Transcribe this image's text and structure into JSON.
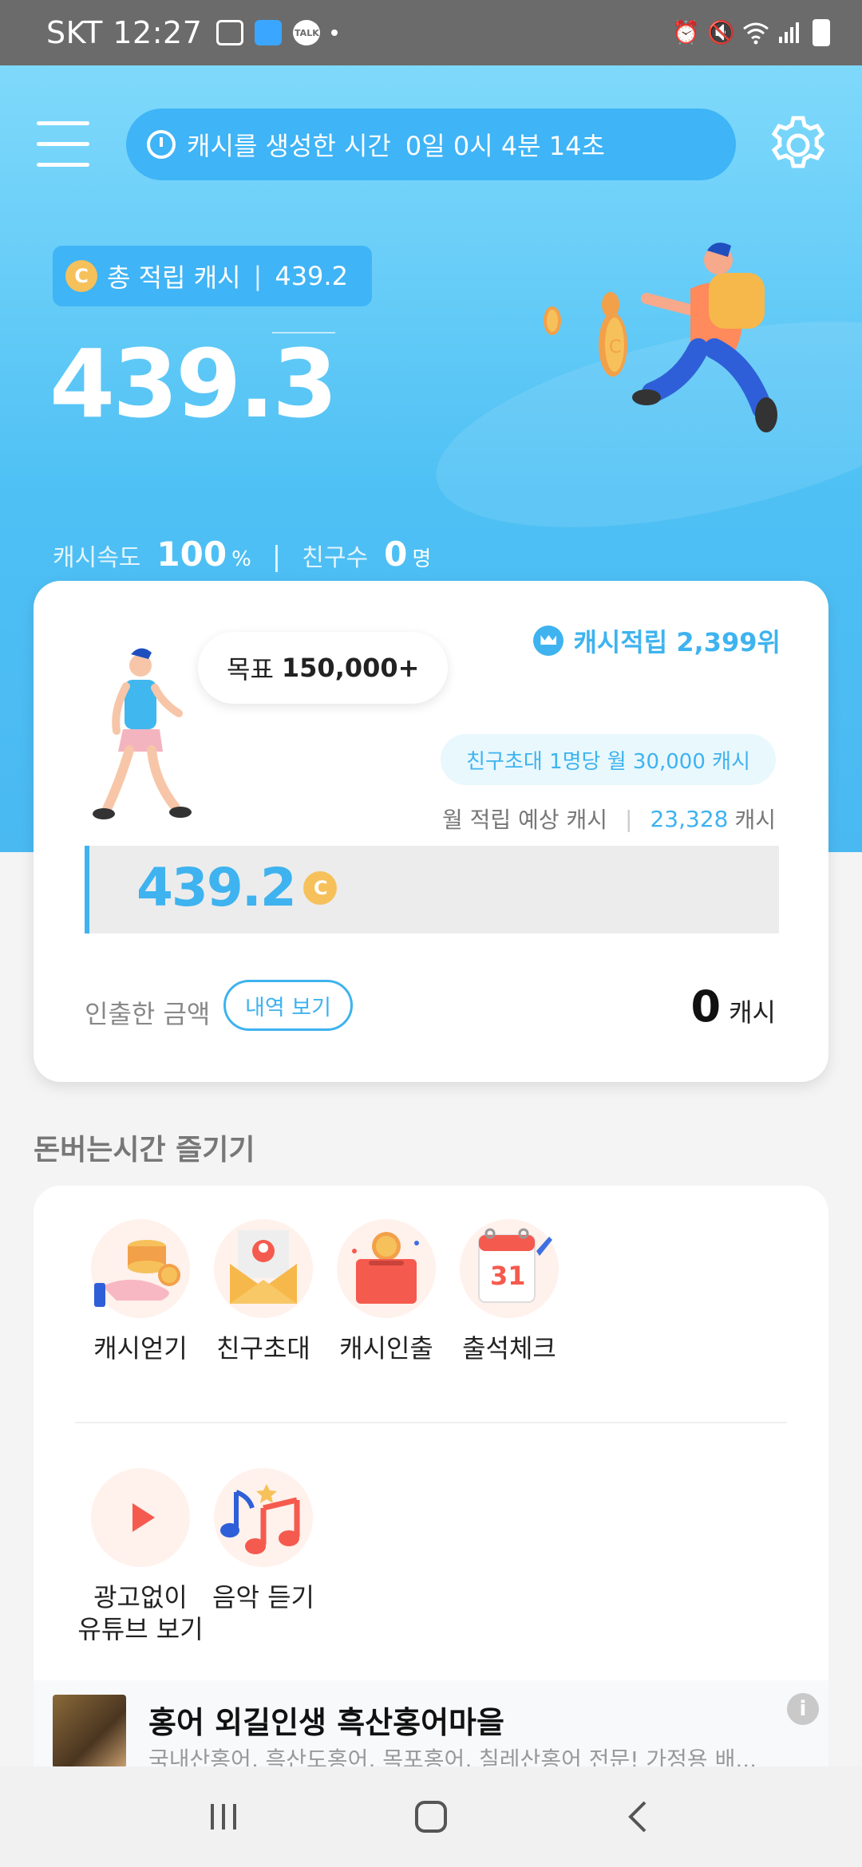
{
  "status_bar": {
    "carrier_time": "SKT 12:27",
    "notif_icons": [
      "image-icon",
      "line-icon",
      "kakaotalk-icon",
      "dot-icon"
    ],
    "talk_text": "TALK",
    "system_icons": [
      "alarm-icon",
      "mute-icon",
      "wifi-icon",
      "signal-icon",
      "battery-icon"
    ]
  },
  "header": {
    "timer_label": "캐시를 생성한 시간",
    "timer_value": "0일 0시 4분 14초"
  },
  "summary": {
    "coin_symbol": "C",
    "total_label": "총 적립 캐시",
    "total_value": "439.2",
    "big_value_main": "439.",
    "big_value_last": "3",
    "speed_label": "캐시속도",
    "speed_value": "100",
    "speed_unit": "%",
    "friends_label": "친구수",
    "friends_value": "0",
    "friends_unit": "명"
  },
  "card": {
    "goal_label": "목표",
    "goal_value": "150,000+",
    "rank_text": "캐시적립 2,399위",
    "invite_text": "친구초대 1명당 월 30,000 캐시",
    "monthly_label": "월 적립 예상 캐시",
    "monthly_value": "23,328",
    "monthly_unit": "캐시",
    "progress_value": "439.2",
    "progress_fraction": 0.0029,
    "withdrawn_label": "인출한 금액",
    "history_button": "내역 보기",
    "withdrawn_value": "0",
    "withdrawn_unit": "캐시"
  },
  "section": {
    "title": "돈버는시간 즐기기",
    "items": [
      {
        "label": "캐시얻기",
        "icon": "hand-coins-icon"
      },
      {
        "label": "친구초대",
        "icon": "envelope-icon"
      },
      {
        "label": "캐시인출",
        "icon": "wallet-icon"
      },
      {
        "label": "출석체크",
        "icon": "calendar-icon"
      },
      {
        "label": "광고없이\n유튜브 보기",
        "icon": "play-icon"
      },
      {
        "label": "음악 듣기",
        "icon": "music-icon"
      }
    ],
    "calendar_day": "31"
  },
  "ad": {
    "title": "홍어 외길인생 흑산홍어마을",
    "description": "국내산홍어, 흑산도홍어, 목포홍어, 칠레산홍어 전문! 가정용 배...",
    "info_symbol": "i"
  },
  "colors": {
    "accent": "#3eb3ef",
    "hero_top": "#7fd9fb",
    "coin": "#f6c15a"
  }
}
